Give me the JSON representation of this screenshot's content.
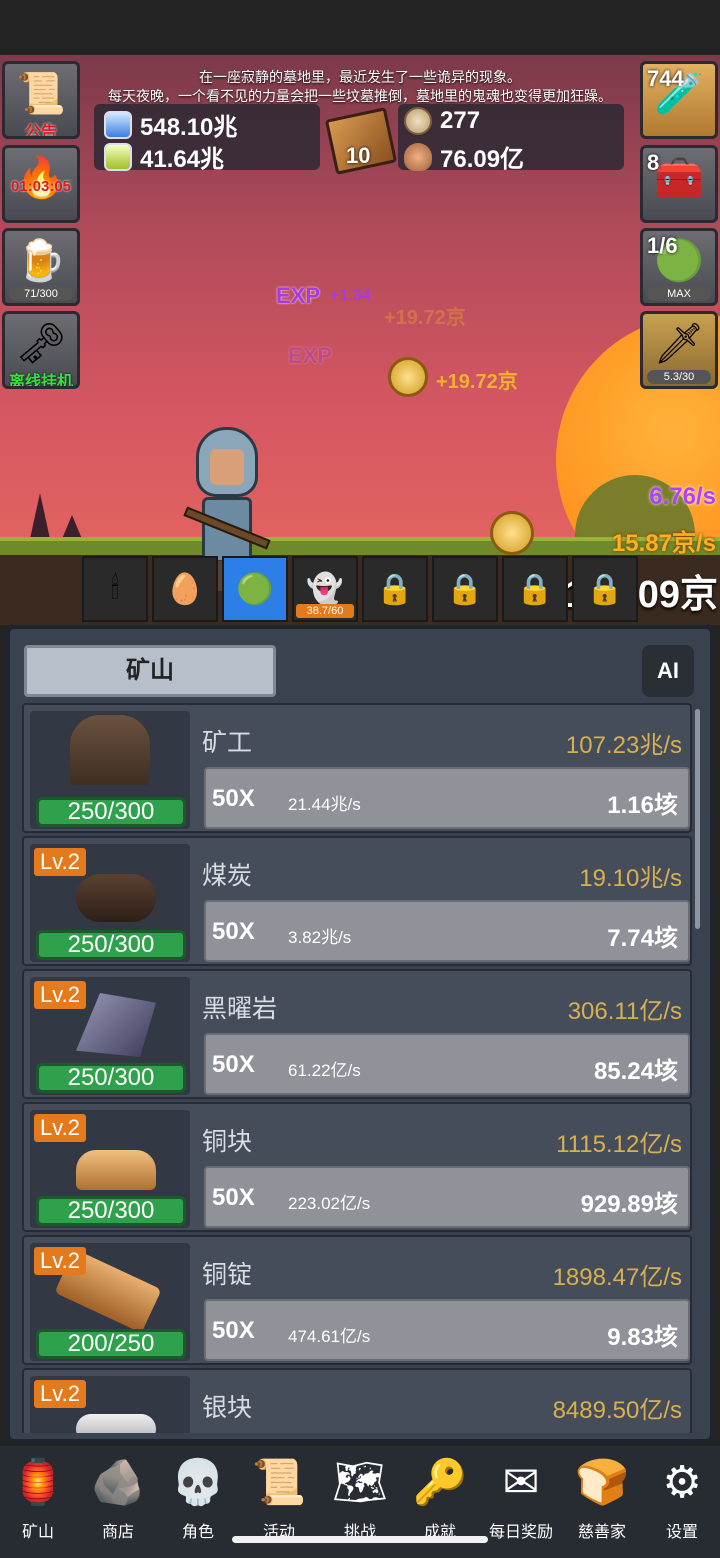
{
  "story": {
    "line1": "在一座寂静的墓地里，最近发生了一些诡异的现象。",
    "line2": "每天夜晚，一个看不见的力量会把一些坟墓推倒，墓地里的鬼魂也变得更加狂躁。"
  },
  "resources": {
    "blue_potion": "548.10兆",
    "green_potion": "41.64兆",
    "book_count": "10",
    "stone": "277",
    "meat": "76.09亿"
  },
  "left_buttons": {
    "notice": "公告",
    "torch_timer": "01:03:05",
    "beer_count": "71/300",
    "offline": "离线挂机"
  },
  "right_buttons": {
    "potion_count": "744",
    "chest_count": "8",
    "slime_count": "1/6",
    "slime_max": "MAX",
    "sword_count": "5.3/30"
  },
  "floating": {
    "exp_label": "EXP",
    "exp_gain": "+1.34",
    "ghost_gain": "+19.72京",
    "gold_gain": "+19.72京"
  },
  "rates": {
    "exp_rate": "6.76/s",
    "gold_rate": "15.87京/s",
    "total_gold": "4140.09京"
  },
  "pets": {
    "ghost_progress": "38.7/60"
  },
  "panel": {
    "tab": "矿山",
    "ai": "AI",
    "rows": [
      {
        "lv": "",
        "name": "矿工",
        "rate": "107.23兆/s",
        "cap": "250/300",
        "mult": "50X",
        "per": "21.44兆/s",
        "cost": "1.16垓"
      },
      {
        "lv": "Lv.2",
        "name": "煤炭",
        "rate": "19.10兆/s",
        "cap": "250/300",
        "mult": "50X",
        "per": "3.82兆/s",
        "cost": "7.74垓"
      },
      {
        "lv": "Lv.2",
        "name": "黑曜岩",
        "rate": "306.11亿/s",
        "cap": "250/300",
        "mult": "50X",
        "per": "61.22亿/s",
        "cost": "85.24垓"
      },
      {
        "lv": "Lv.2",
        "name": "铜块",
        "rate": "1115.12亿/s",
        "cap": "250/300",
        "mult": "50X",
        "per": "223.02亿/s",
        "cost": "929.89垓"
      },
      {
        "lv": "Lv.2",
        "name": "铜锭",
        "rate": "1898.47亿/s",
        "cap": "200/250",
        "mult": "50X",
        "per": "474.61亿/s",
        "cost": "9.83垓"
      },
      {
        "lv": "Lv.2",
        "name": "银块",
        "rate": "8489.50亿/s",
        "cap": "",
        "mult": "",
        "per": "",
        "cost": ""
      }
    ]
  },
  "nav": [
    "矿山",
    "商店",
    "角色",
    "活动",
    "挑战",
    "成就",
    "每日奖励",
    "慈善家",
    "设置"
  ],
  "colors": {
    "accent_orange": "#e47a1c",
    "capacity_green": "#2fa04b",
    "rate_gold": "#d8b050",
    "exp_purple": "#b040ff"
  }
}
